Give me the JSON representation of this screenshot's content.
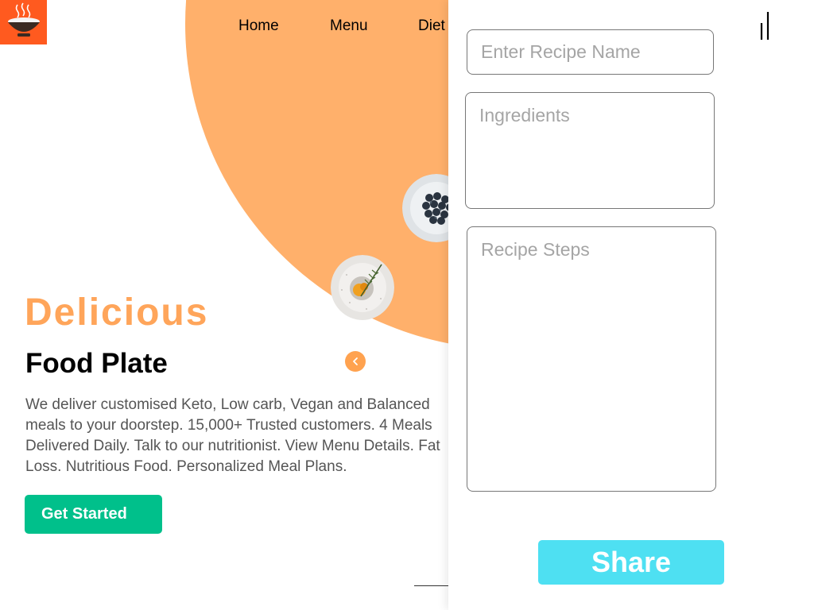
{
  "nav": {
    "items": [
      {
        "label": "Home"
      },
      {
        "label": "Menu"
      },
      {
        "label": "Diet"
      }
    ]
  },
  "hero": {
    "title": "Delicious",
    "subtitle": "Food Plate",
    "description": "We deliver customised Keto, Low carb, Vegan and Balanced meals to your doorstep. 15,000+ Trusted customers. 4 Meals Delivered Daily. Talk to our nutritionist. View Menu Details. Fat Loss. Nutritious Food. Personalized Meal Plans.",
    "cta_label": "Get Started"
  },
  "recipe_form": {
    "name_placeholder": "Enter Recipe Name",
    "ingredients_placeholder": "Ingredients",
    "steps_placeholder": "Recipe Steps",
    "share_label": "Share"
  },
  "icons": {
    "logo": "rice-bowl-icon",
    "prev": "chevron-left-icon",
    "menu": "menu-toggle-icon"
  },
  "colors": {
    "accent_orange": "#ffb06b",
    "title_orange": "#ffa55a",
    "cta_green": "#00c08b",
    "share_cyan": "#4ee0f2",
    "logo_bg": "#ff5a1f"
  }
}
